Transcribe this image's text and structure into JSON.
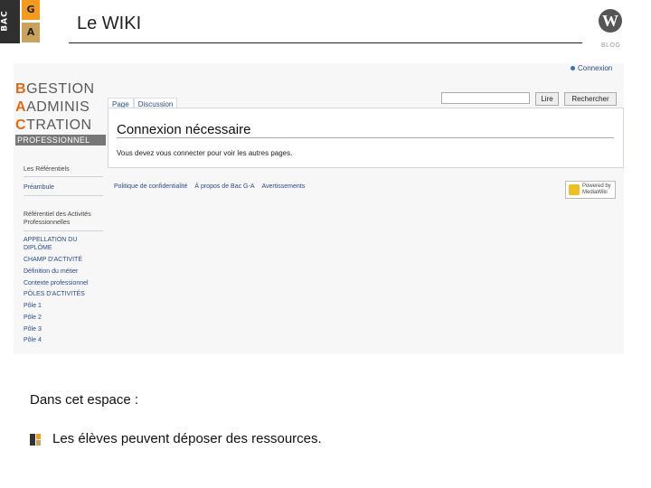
{
  "header": {
    "logo_letters": {
      "vertical": "BAC",
      "top": "G",
      "bottom": "A"
    },
    "title": "Le WIKI",
    "blog_label": "BLOG",
    "wp_icon": "wordpress-icon"
  },
  "wiki": {
    "login_link": "Connexion",
    "logo": {
      "rows": [
        {
          "cap": "B",
          "rest": "GESTION"
        },
        {
          "cap": "A",
          "rest": "ADMINIS"
        },
        {
          "cap": "C",
          "rest": "TRATION"
        }
      ],
      "subtitle": "PROFESSIONNEL"
    },
    "tabs": [
      "Page",
      "Discussion"
    ],
    "search": {
      "value": "",
      "go_label": "Lire",
      "search_label": "Rechercher"
    },
    "heading": "Connexion nécessaire",
    "message": "Vous devez vous connecter pour voir les autres pages.",
    "sidebar": {
      "section1_title": "Les Référentiels",
      "link_preambule": "Préambule",
      "section2_title_line1": "Référentiel des Activités",
      "section2_title_line2": "Professionnelles",
      "links": [
        "APPELLATION DU",
        "DIPLÔME",
        "CHAMP D'ACTIVITÉ",
        "Définition du métier",
        "Contexte professionnel",
        "PÔLES D'ACTIVITÉS",
        "Pôle 1",
        "Pôle 2",
        "Pôle 3",
        "Pôle 4"
      ]
    },
    "footer_links": [
      "Politique de confidentialité",
      "À propos de Bac G-A",
      "Avertissements"
    ],
    "powered_by": {
      "line1": "Powered by",
      "line2": "MediaWiki"
    }
  },
  "content": {
    "section_title": "Dans cet espace :",
    "bullet": "Les élèves peuvent déposer des ressources."
  },
  "colors": {
    "accent_orange": "#f39a1f",
    "accent_tan": "#c9a25c",
    "link_blue": "#2a4b8d"
  }
}
